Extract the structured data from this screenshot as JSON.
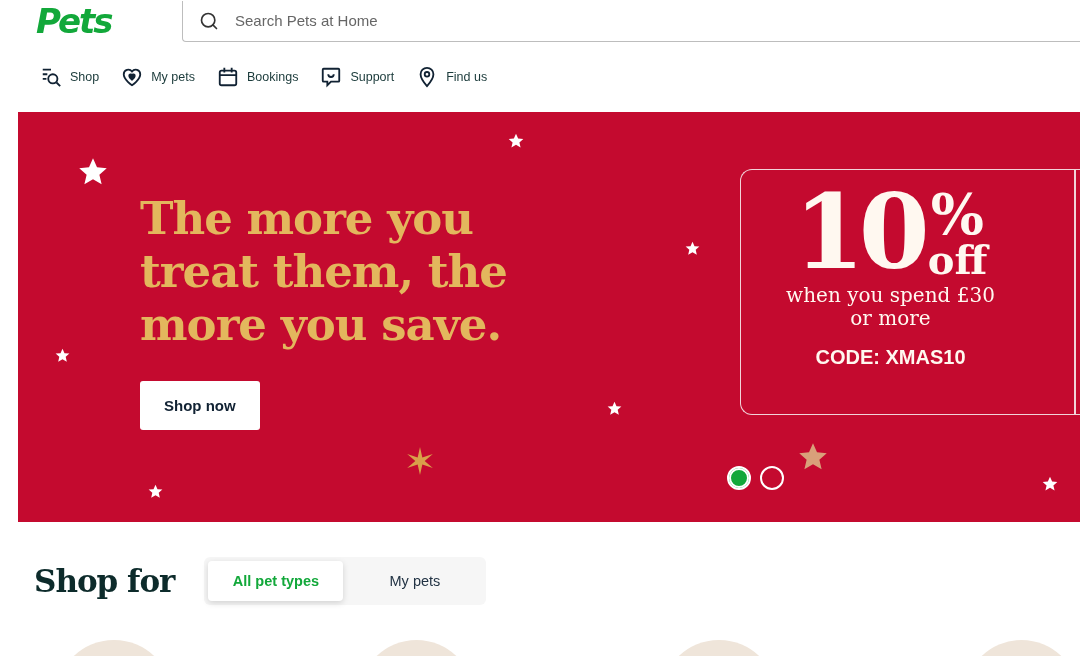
{
  "logo": "Pets",
  "search": {
    "placeholder": "Search Pets at Home"
  },
  "nav": [
    {
      "kind": "shop",
      "label": "Shop"
    },
    {
      "kind": "heart",
      "label": "My pets"
    },
    {
      "kind": "calendar",
      "label": "Bookings"
    },
    {
      "kind": "chat",
      "label": "Support"
    },
    {
      "kind": "pin",
      "label": "Find us"
    }
  ],
  "banner": {
    "headline": "The more you treat them, the more you save.",
    "button": "Shop now",
    "offer": {
      "amount": "10",
      "percent": "%",
      "off": "off",
      "condition": "when you spend £30 or more",
      "code": "CODE: XMAS10"
    },
    "dots": [
      {
        "selected": true
      },
      {
        "selected": false
      }
    ]
  },
  "shop_for": {
    "title": "Shop for",
    "tabs": [
      {
        "label": "All pet types",
        "selected": true
      },
      {
        "label": "My pets",
        "selected": false
      }
    ]
  }
}
